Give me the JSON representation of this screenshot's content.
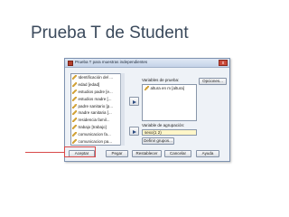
{
  "slide": {
    "title": "Prueba T de Student"
  },
  "dialog": {
    "title": "Prueba T para muestras independientes",
    "close_glyph": "x",
    "source_variables": [
      "Identificación del ...",
      "edad [edad]",
      "estudios padre [e...",
      "estudios madre [...",
      "padre sanitario [p...",
      "madre sanitaria [...",
      "residencia famil...",
      "trabajo [trabajo]",
      "comunicacion fa...",
      "comunicacion pa..."
    ],
    "test_variables_label": "Variables de prueba:",
    "test_variables": [
      "altura en m [altura]"
    ],
    "options_label": "Opciones...",
    "grouping_label": "Variable de agrupación:",
    "grouping_value": "sexo(1 2)",
    "define_groups_label": "Definir grupos...",
    "buttons": {
      "accept": "Aceptar",
      "paste": "Pegar",
      "reset": "Restablecer",
      "cancel": "Cancelar",
      "help": "Ayuda"
    }
  },
  "colors": {
    "highlight": "#d94a4a",
    "grouping_field_bg": "#fff6c8",
    "titlebar": "#c4d3e8"
  },
  "icons": {
    "variable": "ruler-scale-icon",
    "move": "arrow-right-icon"
  }
}
